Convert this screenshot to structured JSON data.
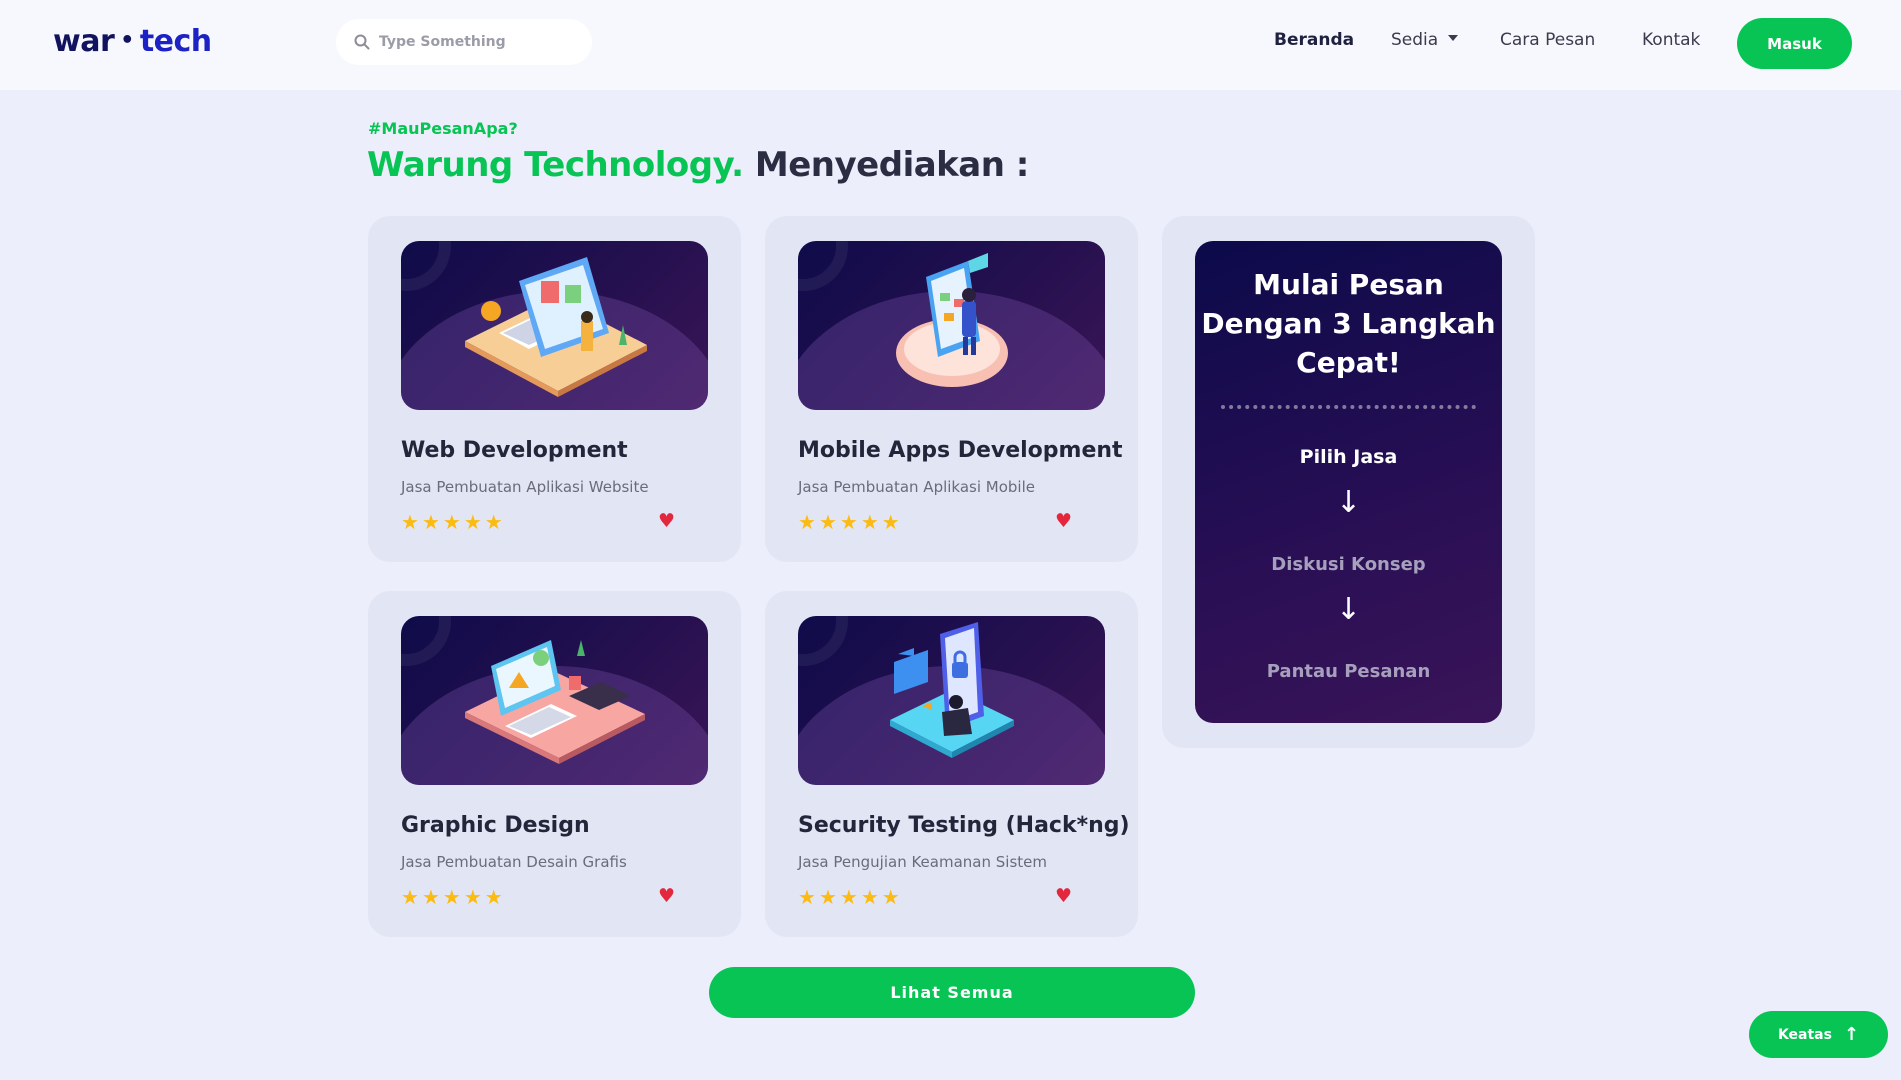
{
  "brand": {
    "part1": "war",
    "dot": "•",
    "part2": "tech"
  },
  "search": {
    "placeholder": "Type Something"
  },
  "nav": {
    "home": "Beranda",
    "sedia": "Sedia",
    "how_to_order": "Cara Pesan",
    "contact": "Kontak",
    "login": "Masuk"
  },
  "hero": {
    "tagline": "#MauPesanApa?",
    "title_green": "Warung Technology.",
    "title_dark": "Menyediakan :"
  },
  "services": [
    {
      "title": "Web Development",
      "subtitle": "Jasa Pembuatan Aplikasi Website",
      "rating": 5,
      "illustration": "web-dev-illustration"
    },
    {
      "title": "Mobile Apps Development",
      "subtitle": "Jasa Pembuatan Aplikasi Mobile",
      "rating": 5,
      "illustration": "mobile-dev-illustration"
    },
    {
      "title": "Graphic Design",
      "subtitle": "Jasa Pembuatan Desain Grafis",
      "rating": 5,
      "illustration": "graphic-design-illustration"
    },
    {
      "title": "Security Testing (Hack*ng)",
      "subtitle": "Jasa Pengujian Keamanan Sistem",
      "rating": 5,
      "illustration": "security-illustration"
    }
  ],
  "steps": {
    "title": "Mulai Pesan Dengan 3 Langkah Cepat!",
    "step1": "Pilih Jasa",
    "step2": "Diskusi Konsep",
    "step3": "Pantau Pesanan",
    "arrow": "↓"
  },
  "buttons": {
    "see_all": "Lihat Semua",
    "back_to_top": "Keatas",
    "back_to_top_icon": "↑"
  },
  "icons": {
    "star": "★",
    "heart": "♥"
  },
  "colors": {
    "accent": "#08c454",
    "brand_dark": "#12135e",
    "brand_blue": "#1d22c4",
    "star": "#fbbb12",
    "heart": "#e3283e"
  }
}
